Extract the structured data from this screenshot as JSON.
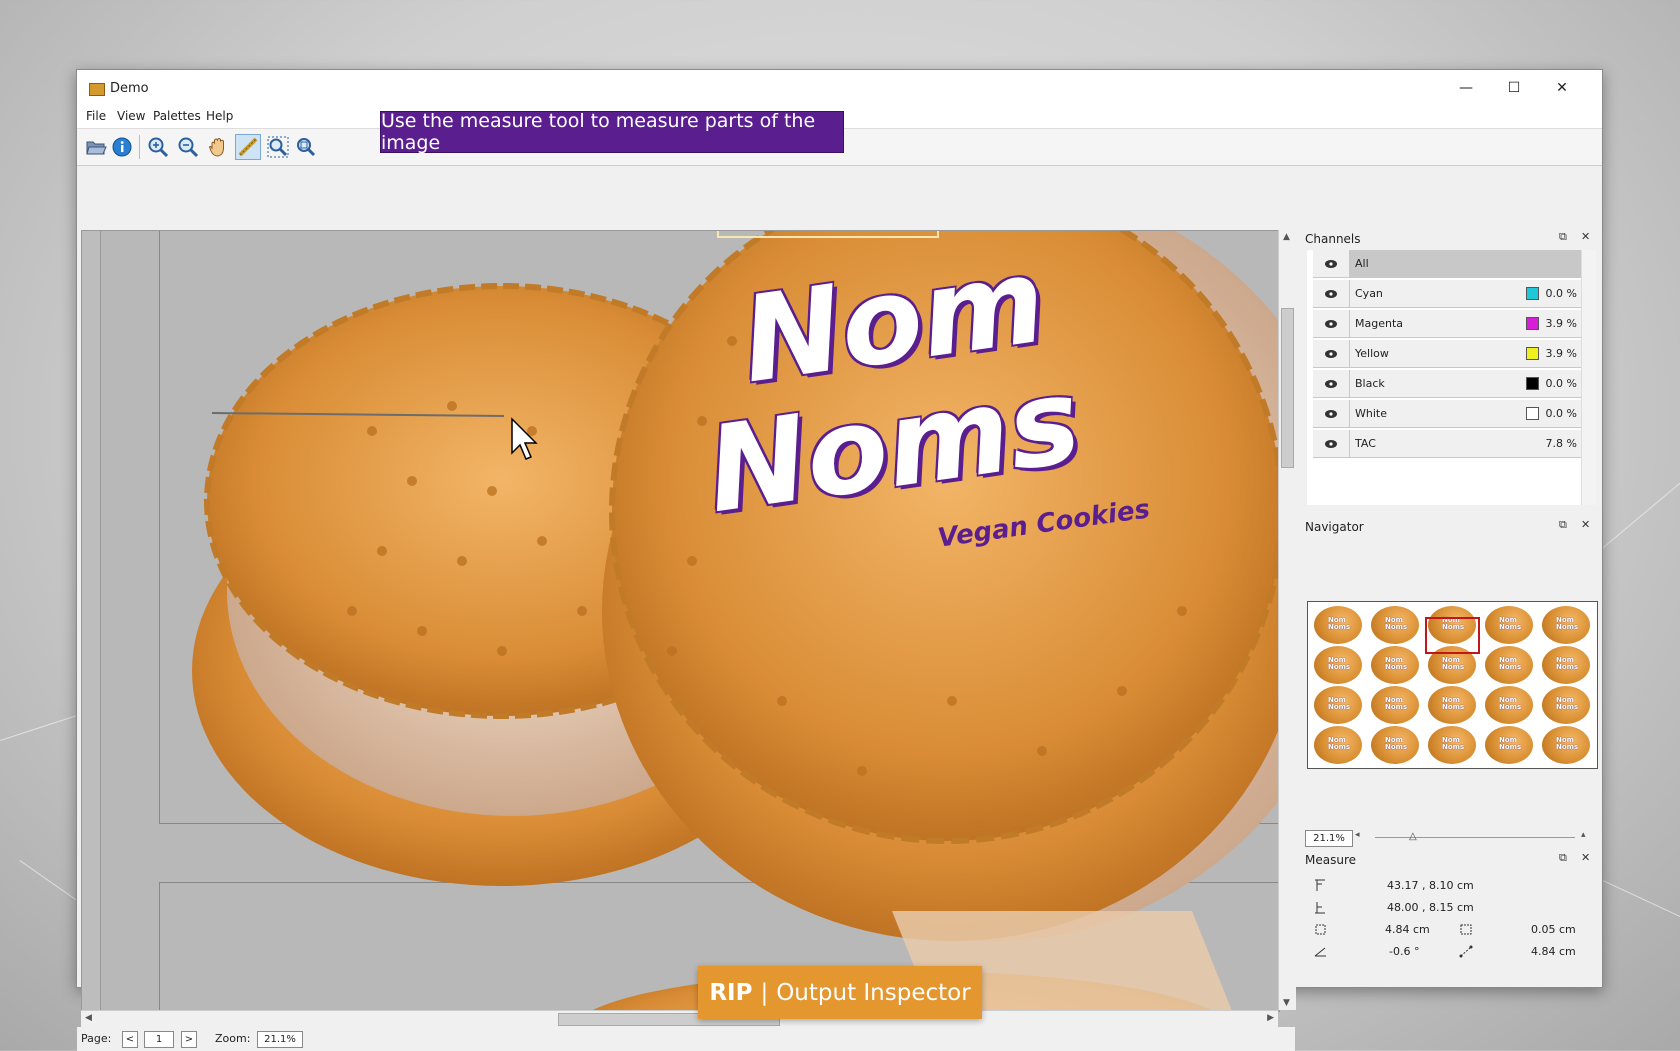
{
  "window": {
    "title": "Demo",
    "controls": {
      "minimize": "—",
      "maximize": "☐",
      "close": "✕"
    }
  },
  "menu": {
    "items": [
      "File",
      "View",
      "Palettes",
      "Help"
    ]
  },
  "toolbar": {
    "tools": [
      "open-icon",
      "info-icon",
      "zoom-in-icon",
      "zoom-out-icon",
      "pan-hand-icon",
      "measure-tool-icon",
      "zoom-area-icon",
      "zoom-fit-icon"
    ],
    "selected_tool": "measure-tool-icon"
  },
  "banner": {
    "text": "Use the measure tool to measure parts of the image"
  },
  "artwork": {
    "brand_line1": "Nom",
    "brand_line2": "Noms",
    "tagline": "Vegan Cookies",
    "brand_color": "#5b1e8f"
  },
  "status": {
    "page_label": "Page:",
    "prev": "<",
    "page": "1",
    "next": ">",
    "zoom_label": "Zoom:",
    "zoom": "21.1%"
  },
  "channels": {
    "title": "Channels",
    "rows": [
      {
        "name": "All",
        "color": "",
        "value": ""
      },
      {
        "name": "Cyan",
        "color": "#1fc8d8",
        "value": "0.0 %"
      },
      {
        "name": "Magenta",
        "color": "#d81fd8",
        "value": "3.9 %"
      },
      {
        "name": "Yellow",
        "color": "#f0f01f",
        "value": "3.9 %"
      },
      {
        "name": "Black",
        "color": "#000000",
        "value": "0.0 %"
      },
      {
        "name": "White",
        "color": "#ffffff",
        "value": "0.0 %"
      },
      {
        "name": "TAC",
        "color": "",
        "value": "7.8 %"
      }
    ]
  },
  "navigator": {
    "title": "Navigator",
    "zoom": "21.1%",
    "thumb_text": "Nom Noms"
  },
  "measure": {
    "title": "Measure",
    "start": "43.17 , 8.10 cm",
    "end": "48.00 , 8.15 cm",
    "width": "4.84 cm",
    "height": "0.05 cm",
    "angle": "-0.6 °",
    "distance": "4.84 cm"
  },
  "badge": {
    "rip": "RIP",
    "divider": "|",
    "product": "Output Inspector"
  }
}
